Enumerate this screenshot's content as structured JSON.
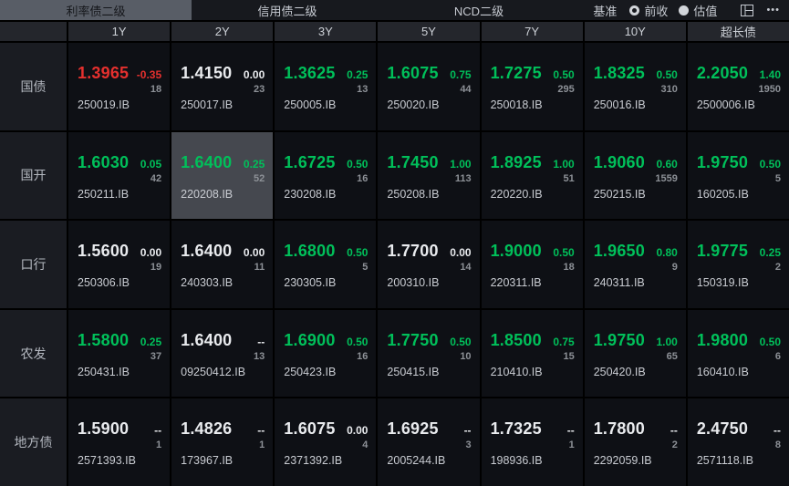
{
  "topbar": {
    "tabs": [
      {
        "label": "利率债二级",
        "selected": true
      },
      {
        "label": "信用债二级",
        "selected": false
      },
      {
        "label": "NCD二级",
        "selected": false
      }
    ],
    "benchmark": {
      "label": "基准",
      "options": [
        {
          "label": "前收",
          "selected": true
        },
        {
          "label": "估值",
          "selected": false
        }
      ]
    },
    "more_label": "•••"
  },
  "grid": {
    "columns": [
      "1Y",
      "2Y",
      "3Y",
      "5Y",
      "7Y",
      "10Y",
      "超长债"
    ],
    "rows": [
      {
        "label": "国债",
        "cells": [
          {
            "yield": "1.3965",
            "change": "-0.35",
            "volume": "18",
            "code": "250019.IB",
            "dir": "down"
          },
          {
            "yield": "1.4150",
            "change": "0.00",
            "volume": "23",
            "code": "250017.IB",
            "dir": "flat"
          },
          {
            "yield": "1.3625",
            "change": "0.25",
            "volume": "13",
            "code": "250005.IB",
            "dir": "up"
          },
          {
            "yield": "1.6075",
            "change": "0.75",
            "volume": "44",
            "code": "250020.IB",
            "dir": "up"
          },
          {
            "yield": "1.7275",
            "change": "0.50",
            "volume": "295",
            "code": "250018.IB",
            "dir": "up"
          },
          {
            "yield": "1.8325",
            "change": "0.50",
            "volume": "310",
            "code": "250016.IB",
            "dir": "up"
          },
          {
            "yield": "2.2050",
            "change": "1.40",
            "volume": "1950",
            "code": "2500006.IB",
            "dir": "up"
          }
        ]
      },
      {
        "label": "国开",
        "cells": [
          {
            "yield": "1.6030",
            "change": "0.05",
            "volume": "42",
            "code": "250211.IB",
            "dir": "up"
          },
          {
            "yield": "1.6400",
            "change": "0.25",
            "volume": "52",
            "code": "220208.IB",
            "dir": "up",
            "highlight": true
          },
          {
            "yield": "1.6725",
            "change": "0.50",
            "volume": "16",
            "code": "230208.IB",
            "dir": "up"
          },
          {
            "yield": "1.7450",
            "change": "1.00",
            "volume": "113",
            "code": "250208.IB",
            "dir": "up"
          },
          {
            "yield": "1.8925",
            "change": "1.00",
            "volume": "51",
            "code": "220220.IB",
            "dir": "up"
          },
          {
            "yield": "1.9060",
            "change": "0.60",
            "volume": "1559",
            "code": "250215.IB",
            "dir": "up"
          },
          {
            "yield": "1.9750",
            "change": "0.50",
            "volume": "5",
            "code": "160205.IB",
            "dir": "up"
          }
        ]
      },
      {
        "label": "口行",
        "cells": [
          {
            "yield": "1.5600",
            "change": "0.00",
            "volume": "19",
            "code": "250306.IB",
            "dir": "flat"
          },
          {
            "yield": "1.6400",
            "change": "0.00",
            "volume": "11",
            "code": "240303.IB",
            "dir": "flat"
          },
          {
            "yield": "1.6800",
            "change": "0.50",
            "volume": "5",
            "code": "230305.IB",
            "dir": "up"
          },
          {
            "yield": "1.7700",
            "change": "0.00",
            "volume": "14",
            "code": "200310.IB",
            "dir": "flat"
          },
          {
            "yield": "1.9000",
            "change": "0.50",
            "volume": "18",
            "code": "220311.IB",
            "dir": "up"
          },
          {
            "yield": "1.9650",
            "change": "0.80",
            "volume": "9",
            "code": "240311.IB",
            "dir": "up"
          },
          {
            "yield": "1.9775",
            "change": "0.25",
            "volume": "2",
            "code": "150319.IB",
            "dir": "up"
          }
        ]
      },
      {
        "label": "农发",
        "cells": [
          {
            "yield": "1.5800",
            "change": "0.25",
            "volume": "37",
            "code": "250431.IB",
            "dir": "up"
          },
          {
            "yield": "1.6400",
            "change": "--",
            "volume": "13",
            "code": "09250412.IB",
            "dir": "flat"
          },
          {
            "yield": "1.6900",
            "change": "0.50",
            "volume": "16",
            "code": "250423.IB",
            "dir": "up"
          },
          {
            "yield": "1.7750",
            "change": "0.50",
            "volume": "10",
            "code": "250415.IB",
            "dir": "up"
          },
          {
            "yield": "1.8500",
            "change": "0.75",
            "volume": "15",
            "code": "210410.IB",
            "dir": "up"
          },
          {
            "yield": "1.9750",
            "change": "1.00",
            "volume": "65",
            "code": "250420.IB",
            "dir": "up"
          },
          {
            "yield": "1.9800",
            "change": "0.50",
            "volume": "6",
            "code": "160410.IB",
            "dir": "up"
          }
        ]
      },
      {
        "label": "地方债",
        "cells": [
          {
            "yield": "1.5900",
            "change": "--",
            "volume": "1",
            "code": "2571393.IB",
            "dir": "flat"
          },
          {
            "yield": "1.4826",
            "change": "--",
            "volume": "1",
            "code": "173967.IB",
            "dir": "flat"
          },
          {
            "yield": "1.6075",
            "change": "0.00",
            "volume": "4",
            "code": "2371392.IB",
            "dir": "flat"
          },
          {
            "yield": "1.6925",
            "change": "--",
            "volume": "3",
            "code": "2005244.IB",
            "dir": "flat"
          },
          {
            "yield": "1.7325",
            "change": "--",
            "volume": "1",
            "code": "198936.IB",
            "dir": "flat"
          },
          {
            "yield": "1.7800",
            "change": "--",
            "volume": "2",
            "code": "2292059.IB",
            "dir": "flat"
          },
          {
            "yield": "2.4750",
            "change": "--",
            "volume": "8",
            "code": "2571118.IB",
            "dir": "flat"
          }
        ]
      }
    ]
  },
  "colors": {
    "up": "#00c05a",
    "down": "#e5302e",
    "flat": "#e9ebee"
  }
}
